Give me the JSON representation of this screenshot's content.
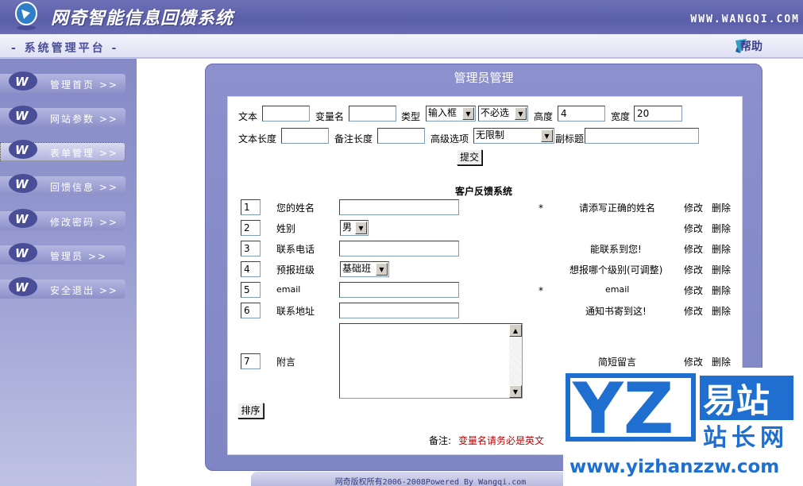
{
  "header": {
    "title": "网奇智能信息回馈系统",
    "url": "WWW.WANGQI.COM",
    "platform": "- 系统管理平台 -",
    "help_label": "帮助"
  },
  "sidebar": {
    "items": [
      {
        "label": "管理首页 >>",
        "active": false
      },
      {
        "label": "网站参数 >>",
        "active": false
      },
      {
        "label": "表单管理 >>",
        "active": true
      },
      {
        "label": "回馈信息 >>",
        "active": false
      },
      {
        "label": "修改密码 >>",
        "active": false
      },
      {
        "label": "管理员 >>",
        "active": false
      },
      {
        "label": "安全退出 >>",
        "active": false
      }
    ]
  },
  "panel": {
    "title": "管理员管理"
  },
  "form": {
    "text_label": "文本",
    "text_value": "",
    "varname_label": "变量名",
    "varname_value": "",
    "type_label": "类型",
    "type_value": "输入框",
    "required_value": "不必选",
    "height_label": "高度",
    "height_value": "4",
    "width_label": "宽度",
    "width_value": "20",
    "textlen_label": "文本长度",
    "textlen_value": "",
    "notelen_label": "备注长度",
    "notelen_value": "",
    "advanced_label": "高级选项",
    "advanced_value": "无限制",
    "subtitle_label": "副标题",
    "subtitle_value": "",
    "submit_label": "提交"
  },
  "feedback": {
    "title": "客户反馈系统",
    "edit_label": "修改",
    "delete_label": "删除",
    "rows": [
      {
        "order": "1",
        "name": "您的姓名",
        "required": "*",
        "note": "请添写正确的姓名"
      },
      {
        "order": "2",
        "name": "姓别",
        "select_value": "男",
        "required": "",
        "note": ""
      },
      {
        "order": "3",
        "name": "联系电话",
        "required": "",
        "note": "能联系到您!"
      },
      {
        "order": "4",
        "name": "预报班级",
        "select_value": "基础班",
        "required": "",
        "note": "想报哪个级别(可调整)"
      },
      {
        "order": "5",
        "name": "email",
        "required": "*",
        "note": "email"
      },
      {
        "order": "6",
        "name": "联系地址",
        "required": "",
        "note": "通知书寄到这!"
      },
      {
        "order": "7",
        "name": "附言",
        "required": "",
        "note": "简短留言"
      }
    ],
    "sort_label": "排序",
    "remark_prefix": "备注:",
    "remark_text": "变量名请务必是英文"
  },
  "footer": {
    "text": "网奇版权所有2006-2008Powered By Wangqi.com"
  },
  "watermark": {
    "letters": "YZ",
    "brand": "易站",
    "subtitle": "站长网",
    "url": "www.yizhanzzw.com"
  },
  "colors": {
    "banner": "#5a5ea8",
    "panel": "#8085c4",
    "watermark": "#1f6fd0",
    "remark": "#c00000"
  }
}
